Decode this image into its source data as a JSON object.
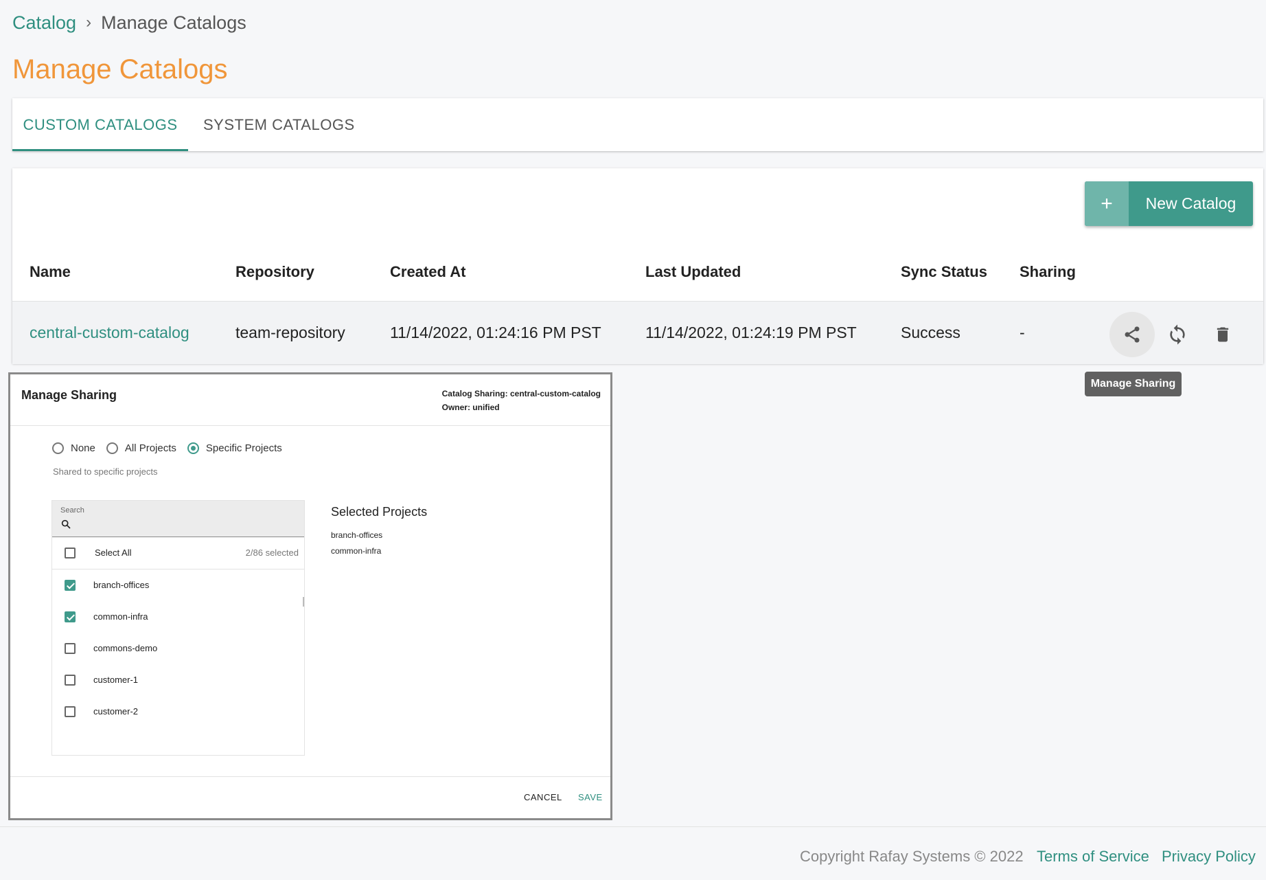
{
  "breadcrumb": {
    "root": "Catalog",
    "separator": "›",
    "current": "Manage Catalogs"
  },
  "page_title": "Manage Catalogs",
  "tabs": [
    {
      "label": "CUSTOM CATALOGS",
      "active": true
    },
    {
      "label": "SYSTEM CATALOGS",
      "active": false
    }
  ],
  "new_button": {
    "icon": "plus-icon",
    "plus": "+",
    "label": "New Catalog"
  },
  "table": {
    "columns": [
      "Name",
      "Repository",
      "Created At",
      "Last Updated",
      "Sync Status",
      "Sharing"
    ],
    "rows": [
      {
        "name": "central-custom-catalog",
        "repository": "team-repository",
        "created_at": "11/14/2022, 01:24:16 PM PST",
        "last_updated": "11/14/2022, 01:24:19 PM PST",
        "sync_status": "Success",
        "sharing": "-"
      }
    ],
    "actions": [
      "share-icon",
      "sync-icon",
      "trash-icon"
    ]
  },
  "tooltip": "Manage Sharing",
  "dialog": {
    "title": "Manage Sharing",
    "meta_line1": "Catalog Sharing: central-custom-catalog",
    "meta_line2": "Owner: unified",
    "options": [
      {
        "label": "None",
        "selected": false
      },
      {
        "label": "All Projects",
        "selected": false
      },
      {
        "label": "Specific Projects",
        "selected": true
      }
    ],
    "hint": "Shared to specific projects",
    "search_label": "Search",
    "select_all": "Select All",
    "selected_count": "2/86 selected",
    "projects": [
      {
        "label": "branch-offices",
        "checked": true
      },
      {
        "label": "common-infra",
        "checked": true
      },
      {
        "label": "commons-demo",
        "checked": false
      },
      {
        "label": "customer-1",
        "checked": false
      },
      {
        "label": "customer-2",
        "checked": false
      }
    ],
    "selected_title": "Selected Projects",
    "selected_projects": [
      "branch-offices",
      "common-infra"
    ],
    "cancel": "CANCEL",
    "save": "SAVE"
  },
  "footer": {
    "copyright": "Copyright Rafay Systems © 2022",
    "terms": "Terms of Service",
    "privacy": "Privacy Policy"
  },
  "colors": {
    "accent": "#2f8f80",
    "title": "#f0963a",
    "button": "#3f9a8b"
  }
}
